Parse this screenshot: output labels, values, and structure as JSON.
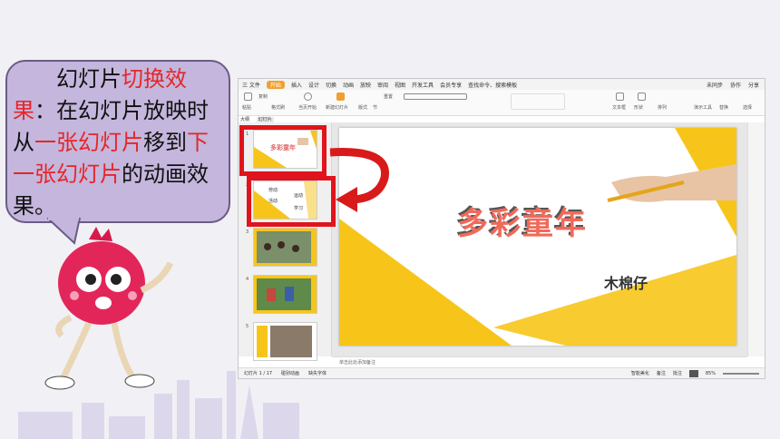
{
  "bubble": {
    "line_parts": [
      {
        "text": "幻灯片",
        "highlight": false
      },
      {
        "text": "切换效果",
        "highlight": true
      },
      {
        "text": "：在幻灯片放映时从",
        "highlight": false
      },
      {
        "text": "一张幻灯片",
        "highlight": true
      },
      {
        "text": "移到",
        "highlight": false
      },
      {
        "text": "下一张幻灯片",
        "highlight": true
      },
      {
        "text": "的动画效果。",
        "highlight": false
      }
    ]
  },
  "app": {
    "titlebar": {
      "menu": "三 文件",
      "tabs": [
        "开始",
        "插入",
        "设计",
        "切换",
        "动画",
        "放映",
        "审阅",
        "视图",
        "开发工具",
        "会员专享"
      ],
      "search": "查找命令、搜索模板",
      "right": [
        "未同步",
        "协作",
        "分享"
      ]
    },
    "ribbon": {
      "labels": [
        "粘贴",
        "复制",
        "格式刷",
        "当页开始",
        "新建幻灯片",
        "版式",
        "节",
        "重置",
        "文本框",
        "形状",
        "排列",
        "演示工具",
        "替换",
        "选择"
      ]
    },
    "panel_tabs": [
      "大纲",
      "幻灯片"
    ],
    "thumbnails": [
      {
        "num": "1",
        "title": "多彩童年"
      },
      {
        "num": "2",
        "words": [
          "劳动",
          "运动",
          "活动",
          "学习"
        ]
      },
      {
        "num": "3"
      },
      {
        "num": "4"
      },
      {
        "num": "5"
      }
    ],
    "slide": {
      "title": "多彩童年",
      "subtitle": "木棉仔"
    },
    "notes_placeholder": "单击此处添加备注",
    "status": {
      "slide_counter": "幻灯片 1 / 17",
      "theme": "碰别动画",
      "font": "缺失字体",
      "beautify": "智能美化",
      "notes": "备注",
      "comment": "批注",
      "zoom": "85%"
    }
  },
  "colors": {
    "accent": "#f0a030",
    "slide_yellow": "#f7c51a",
    "highlight_red": "#e5262a",
    "bubble": "#c4b6dc"
  }
}
